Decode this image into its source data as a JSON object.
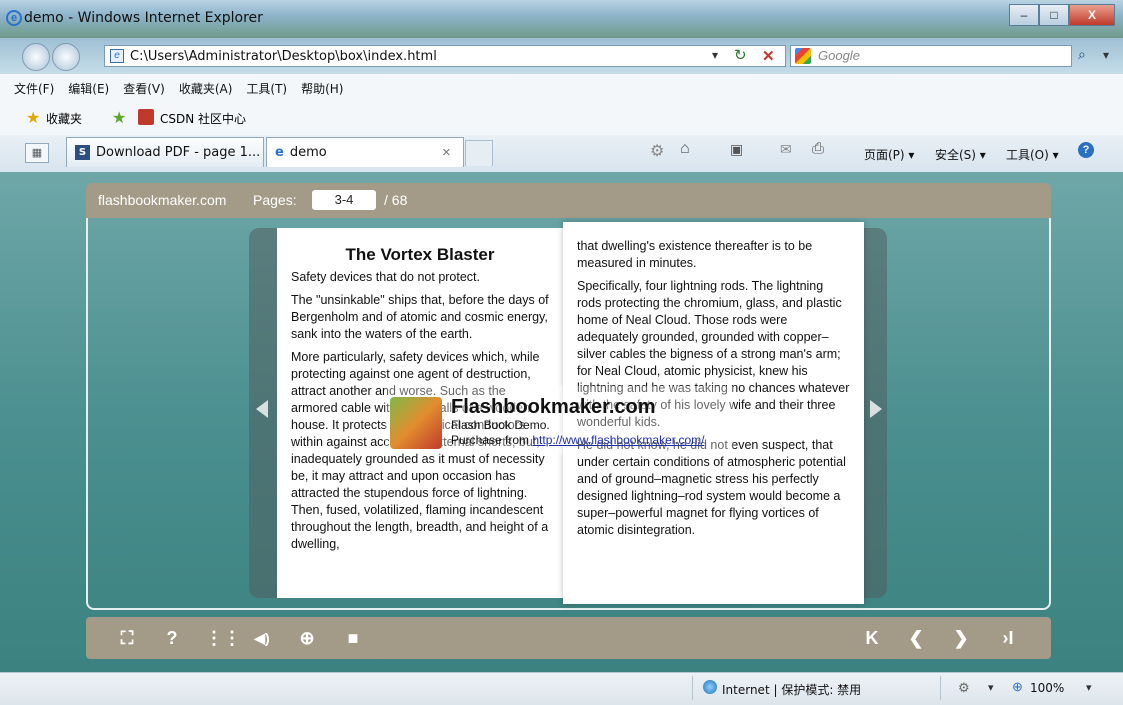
{
  "window": {
    "title": "demo - Windows Internet Explorer",
    "buttons": {
      "minimize": "–",
      "maximize": "□",
      "close": "X"
    }
  },
  "nav": {
    "address": "C:\\Users\\Administrator\\Desktop\\box\\index.html",
    "search_placeholder": "Google",
    "refresh": "↻",
    "stop": "✕",
    "dropdown": "▾",
    "search_go": "⌕"
  },
  "menu": [
    "文件(F)",
    "编辑(E)",
    "查看(V)",
    "收藏夹(A)",
    "工具(T)",
    "帮助(H)"
  ],
  "favorites": {
    "label": "收藏夹",
    "link1": "CSDN 社区中心"
  },
  "tabs": {
    "tab1": "Download PDF - page 1...",
    "tab2": "demo",
    "tab2_close": "×",
    "tools": [
      "页面(P) ▾",
      "安全(S) ▾",
      "工具(O) ▾"
    ]
  },
  "flipbook": {
    "site": "flashbookmaker.com",
    "pages_label": "Pages:",
    "page_value": "3-4",
    "total": "/ 68",
    "left_page": {
      "title": "The Vortex Blaster",
      "paragraphs": [
        "Safety devices that do not protect.",
        "The \"unsinkable\" ships that, before the days of Bergenholm and of atomic and cosmic energy, sank into the waters of the earth.",
        "More particularly, safety devices which, while protecting against one agent of destruction, attract another and worse. Such as the armored cable within the walls of a wooden house. It protects the electrical conductors within against accidental external shorts; but, inadequately grounded as it must of necessity be, it may attract and upon occasion has attracted the stupendous force of lightning. Then, fused, volatilized, flaming incandescent throughout the length, breadth, and height of a dwelling,"
      ]
    },
    "right_page": {
      "paragraphs": [
        "that dwelling's existence thereafter is to be measured in minutes.",
        "Specifically, four lightning rods. The lightning rods protecting the chromium, glass, and plastic home of Neal Cloud. Those rods were adequately grounded, grounded with copper–silver cables the bigness of a strong man's arm; for Neal Cloud, atomic physicist, knew his lightning and he was taking no chances whatever with the safety of his lovely wife and their three wonderful kids.",
        "He did not know, he did not even suspect, that under certain conditions of atmospheric potential and of ground–magnetic stress his perfectly designed lightning–rod system would become a super–powerful magnet for flying vortices of atomic disintegration."
      ]
    },
    "watermark": {
      "title": "Flashbookmaker.com",
      "subtitle": "Flash Book Demo.",
      "purchase": "Purchase from",
      "url": "http://www.flashbookmaker.com/"
    },
    "toolbar_left": [
      "⛶",
      "?",
      "⋮⋮",
      "◀)",
      "⊕",
      "■"
    ],
    "toolbar_right": [
      "K",
      "❮",
      "❯",
      "›I"
    ]
  },
  "status": {
    "zone": "Internet | 保护模式: 禁用",
    "zoom": "100%"
  }
}
